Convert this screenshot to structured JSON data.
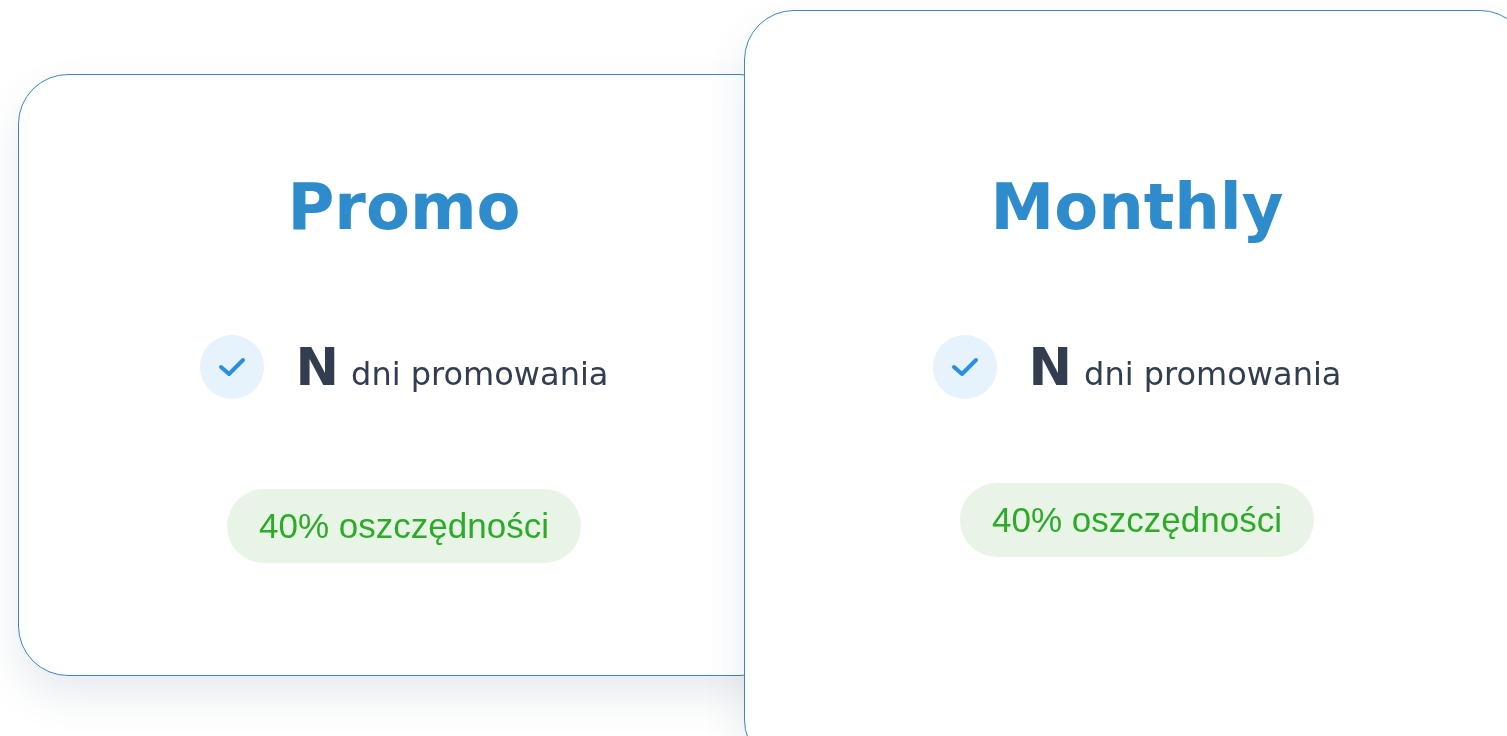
{
  "cards": [
    {
      "title": "Promo",
      "feature": {
        "count": "N",
        "text": "dni promowania"
      },
      "badge": "40% oszczędności"
    },
    {
      "title": "Monthly",
      "feature": {
        "count": "N",
        "text": "dni promowania"
      },
      "badge": "40% oszczędności"
    }
  ]
}
